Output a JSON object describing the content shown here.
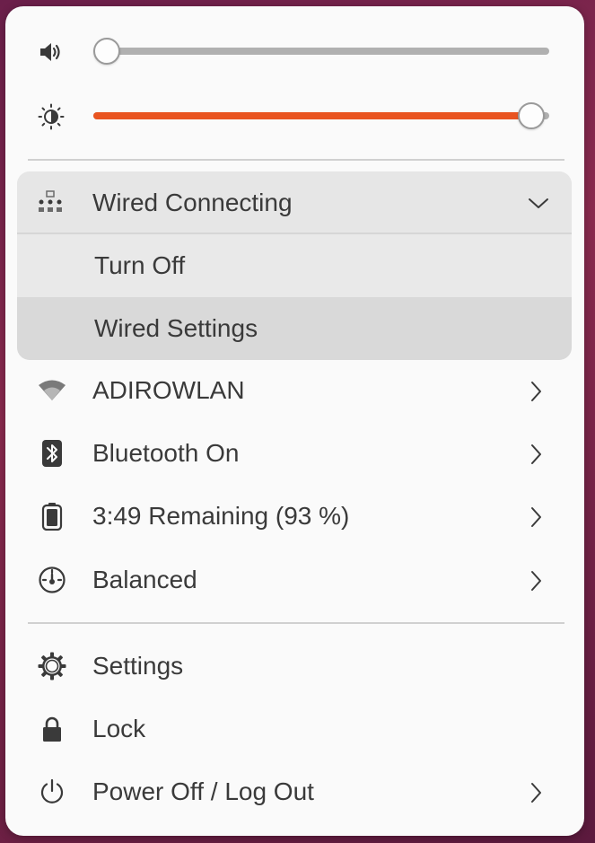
{
  "sliders": {
    "volume": {
      "icon": "speaker-icon",
      "level": 0.0
    },
    "brightness": {
      "icon": "brightness-icon",
      "level": 0.96,
      "fill_color": "#e95420"
    }
  },
  "wired": {
    "label": "Wired Connecting",
    "icon": "wired-network-icon",
    "expand_icon": "chevron-down-icon",
    "submenu": [
      {
        "label": "Turn Off"
      },
      {
        "label": "Wired Settings"
      }
    ]
  },
  "items": [
    {
      "label": "ADIROWLAN",
      "icon": "wifi-icon",
      "has_submenu": true
    },
    {
      "label": "Bluetooth On",
      "icon": "bluetooth-icon",
      "has_submenu": true
    },
    {
      "label": "3:49 Remaining (93 %)",
      "icon": "battery-icon",
      "has_submenu": true
    },
    {
      "label": "Balanced",
      "icon": "power-profile-icon",
      "has_submenu": true
    }
  ],
  "actions": [
    {
      "label": "Settings",
      "icon": "gear-icon",
      "has_submenu": false
    },
    {
      "label": "Lock",
      "icon": "lock-icon",
      "has_submenu": false
    },
    {
      "label": "Power Off / Log Out",
      "icon": "power-icon",
      "has_submenu": true
    }
  ],
  "colors": {
    "accent": "#e95420",
    "menu_background": "#fafafa",
    "text": "#3a3a3a"
  }
}
